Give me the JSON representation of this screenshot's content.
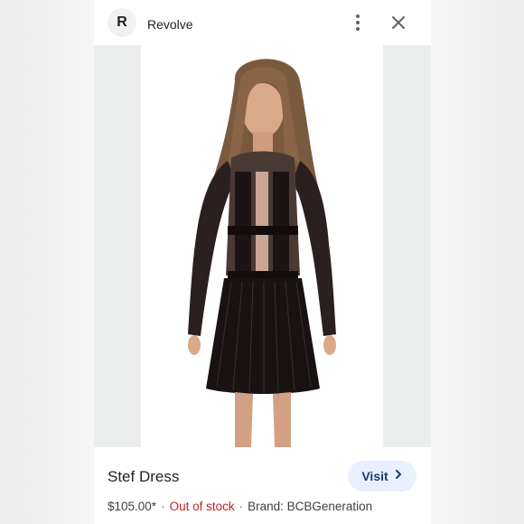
{
  "source": {
    "avatar_letter": "R",
    "name": "Revolve"
  },
  "header": {
    "more_icon": "more-vert-icon",
    "close_icon": "close-icon"
  },
  "image": {
    "subject": "model-in-black-lace-dress"
  },
  "product": {
    "title": "Stef Dress",
    "price": "$105.00*",
    "separator": "·",
    "stock_status": "Out of stock",
    "brand": "Brand: BCBGeneration"
  },
  "visit_button": {
    "label": "Visit",
    "icon": "chevron-right-icon"
  },
  "colors": {
    "out_of_stock": "#c5221f",
    "visit_bg": "#e8f0fe",
    "visit_text": "#1a3a6b"
  }
}
